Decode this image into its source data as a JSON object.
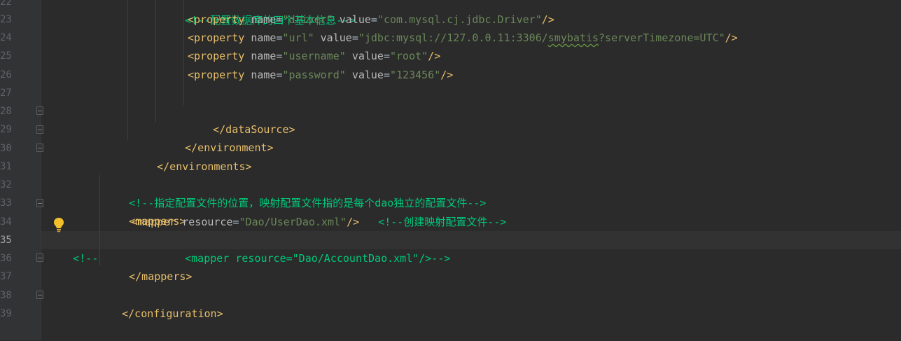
{
  "editor": {
    "current_line": "35",
    "lines": [
      {
        "num": "22",
        "text": "<!--配置数据库的四个基本信息-->"
      },
      {
        "num": "23",
        "tag_open": "<property",
        "attr1": "name",
        "val1": "\"driver\"",
        "attr2": "value",
        "val2": "\"com.mysql.cj.jdbc.Driver\"",
        "tag_close": "/>"
      },
      {
        "num": "24",
        "tag_open": "<property",
        "attr1": "name",
        "val1": "\"url\"",
        "attr2": "value",
        "val2a": "\"jdbc:mysql://127.0.0.11:3306/",
        "val2b": "smybatis",
        "val2c": "?serverTimezone=UTC\"",
        "tag_close": "/>"
      },
      {
        "num": "25",
        "tag_open": "<property",
        "attr1": "name",
        "val1": "\"username\"",
        "attr2": "value",
        "val2": "\"root\"",
        "tag_close": "/>"
      },
      {
        "num": "26",
        "tag_open": "<property",
        "attr1": "name",
        "val1": "\"password\"",
        "attr2": "value",
        "val2": "\"123456\"",
        "tag_close": "/>"
      },
      {
        "num": "27",
        "text": ""
      },
      {
        "num": "28",
        "text": "</dataSource>"
      },
      {
        "num": "29",
        "text": "</environment>"
      },
      {
        "num": "30",
        "text": "</environments>"
      },
      {
        "num": "31",
        "text": ""
      },
      {
        "num": "32",
        "text": "<!--指定配置文件的位置，映射配置文件指的是每个dao独立的配置文件-->"
      },
      {
        "num": "33",
        "text": "<mappers>"
      },
      {
        "num": "34",
        "tag_open": "<mapper",
        "attr1": "resource",
        "val1": "\"Dao/UserDao.xml\"",
        "tag_close": "/>",
        "comment": "<!--创建映射配置文件-->"
      },
      {
        "num": "35",
        "prefix": "<!--",
        "text": "<mapper resource=\"Dao/AccountDao.xml\"/>-->"
      },
      {
        "num": "36",
        "text": "</mappers>"
      },
      {
        "num": "37",
        "text": ""
      },
      {
        "num": "38",
        "text": "</configuration>"
      },
      {
        "num": "39",
        "text": ""
      }
    ],
    "eq_sign": "="
  },
  "colors": {
    "background": "#2b2b2b",
    "gutter": "#313335",
    "tag": "#e8bf6a",
    "attribute": "#bababa",
    "string": "#6a8759",
    "comment": "#00c77a"
  },
  "icons": {
    "intention_bulb": "lightbulb-icon",
    "fold_marker": "fold-marker-icon"
  }
}
